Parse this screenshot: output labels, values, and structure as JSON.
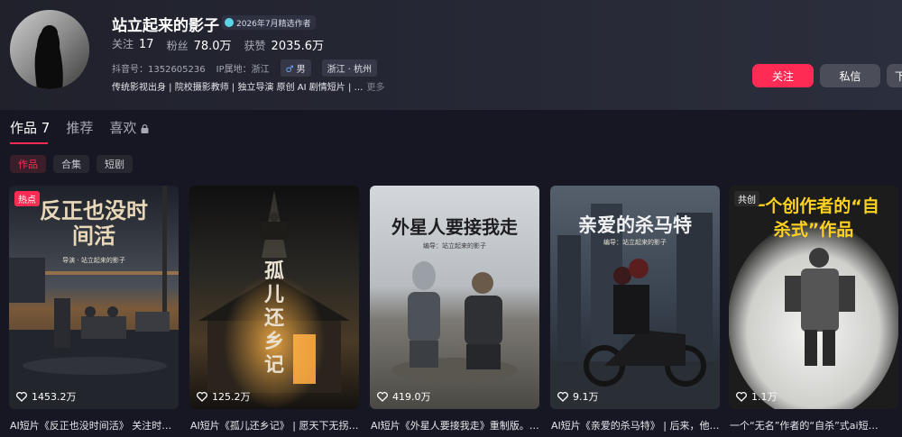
{
  "profile": {
    "name": "站立起来的影子",
    "badge": "2026年7月精选作者",
    "stats": [
      {
        "label": "关注",
        "value": "17"
      },
      {
        "label": "粉丝",
        "value": "78.0万"
      },
      {
        "label": "获赞",
        "value": "2035.6万"
      }
    ],
    "douyin_id": "抖音号：1352605236",
    "ip": "IP属地：浙江",
    "gender": "男",
    "location": "浙江 · 杭州",
    "bio": "传统影视出身 | 院校摄影教师 | 独立导演 原创 AI 剧情短片 | …",
    "bio_more": "更多"
  },
  "actions": {
    "follow": "关注",
    "message": "私信",
    "more": "下"
  },
  "tabs": [
    {
      "label": "作品 7"
    },
    {
      "label": "推荐"
    },
    {
      "label": "喜欢"
    }
  ],
  "subtabs": [
    "作品",
    "合集",
    "短剧"
  ],
  "videos": [
    {
      "thumb_title": "反正也没时间活",
      "thumb_sub": "导演 · 站立起来的影子",
      "corner": "热点",
      "likes": "1453.2万",
      "caption": "AI短片《反正也没时间活》 关注时间…"
    },
    {
      "thumb_title": "孤儿还乡记",
      "thumb_sub": "",
      "corner": "",
      "likes": "125.2万",
      "caption": "AI短片《孤儿还乡记》 | 愿天下无拐…"
    },
    {
      "thumb_title": "外星人要接我走",
      "thumb_sub": "编导：站立起来的影子",
      "corner": "",
      "likes": "419.0万",
      "caption": "AI短片《外星人要接我走》重制版。…"
    },
    {
      "thumb_title": "亲爱的杀马特",
      "thumb_sub": "编导：站立起来的影子",
      "corner": "",
      "likes": "9.1万",
      "caption": "AI短片《亲爱的杀马特》 | 后来，他…"
    },
    {
      "thumb_title": "一个创作者的“自杀式”作品",
      "thumb_sub": "",
      "corner": "共创",
      "likes": "1.1万",
      "caption": "一个“无名”作者的“自杀”式ai短…"
    }
  ],
  "colors": {
    "accent": "#fe2c55",
    "background": "#161722"
  }
}
